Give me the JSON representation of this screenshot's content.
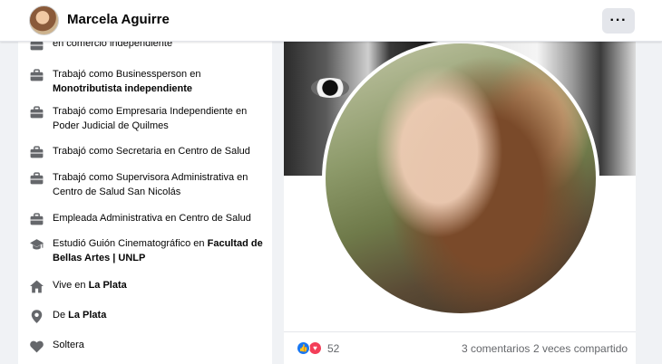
{
  "header": {
    "name": "Marcela Aguirre",
    "more_icon": "ellipsis-icon",
    "more_label": "···"
  },
  "intro": {
    "items": [
      {
        "icon": "briefcase-icon",
        "text": "en comercio independiente"
      },
      {
        "icon": "briefcase-icon",
        "prefix": "Trabajó como Businessperson en",
        "bold": "Monotributista independiente"
      },
      {
        "icon": "briefcase-icon",
        "text": "Trabajó como Empresaria Independiente en Poder Judicial de Quilmes"
      },
      {
        "icon": "briefcase-icon",
        "text": "Trabajó como Secretaria en Centro de Salud"
      },
      {
        "icon": "briefcase-icon",
        "text": "Trabajó como Supervisora Administrativa en Centro de Salud San Nicolás"
      },
      {
        "icon": "briefcase-icon",
        "text": "Empleada Administrativa en Centro de Salud"
      },
      {
        "icon": "graduation-cap-icon",
        "prefix": "Estudió Guión Cinematográfico en",
        "bold": "Facultad de Bellas Artes | UNLP"
      },
      {
        "icon": "home-icon",
        "prefix": "Vive en",
        "bold": "La Plata"
      },
      {
        "icon": "location-pin-icon",
        "prefix": "De",
        "bold": "La Plata"
      },
      {
        "icon": "heart-icon",
        "text": "Soltera"
      }
    ]
  },
  "post": {
    "reaction_icons": [
      "like-icon",
      "love-icon"
    ],
    "reaction_count": "52",
    "comments": "3 comentarios",
    "shares": "2 veces compartido"
  },
  "colors": {
    "background": "#f0f2f5",
    "card": "#ffffff",
    "secondary_text": "#65676b",
    "like_blue": "#1877f2",
    "love_red": "#f33e58"
  }
}
